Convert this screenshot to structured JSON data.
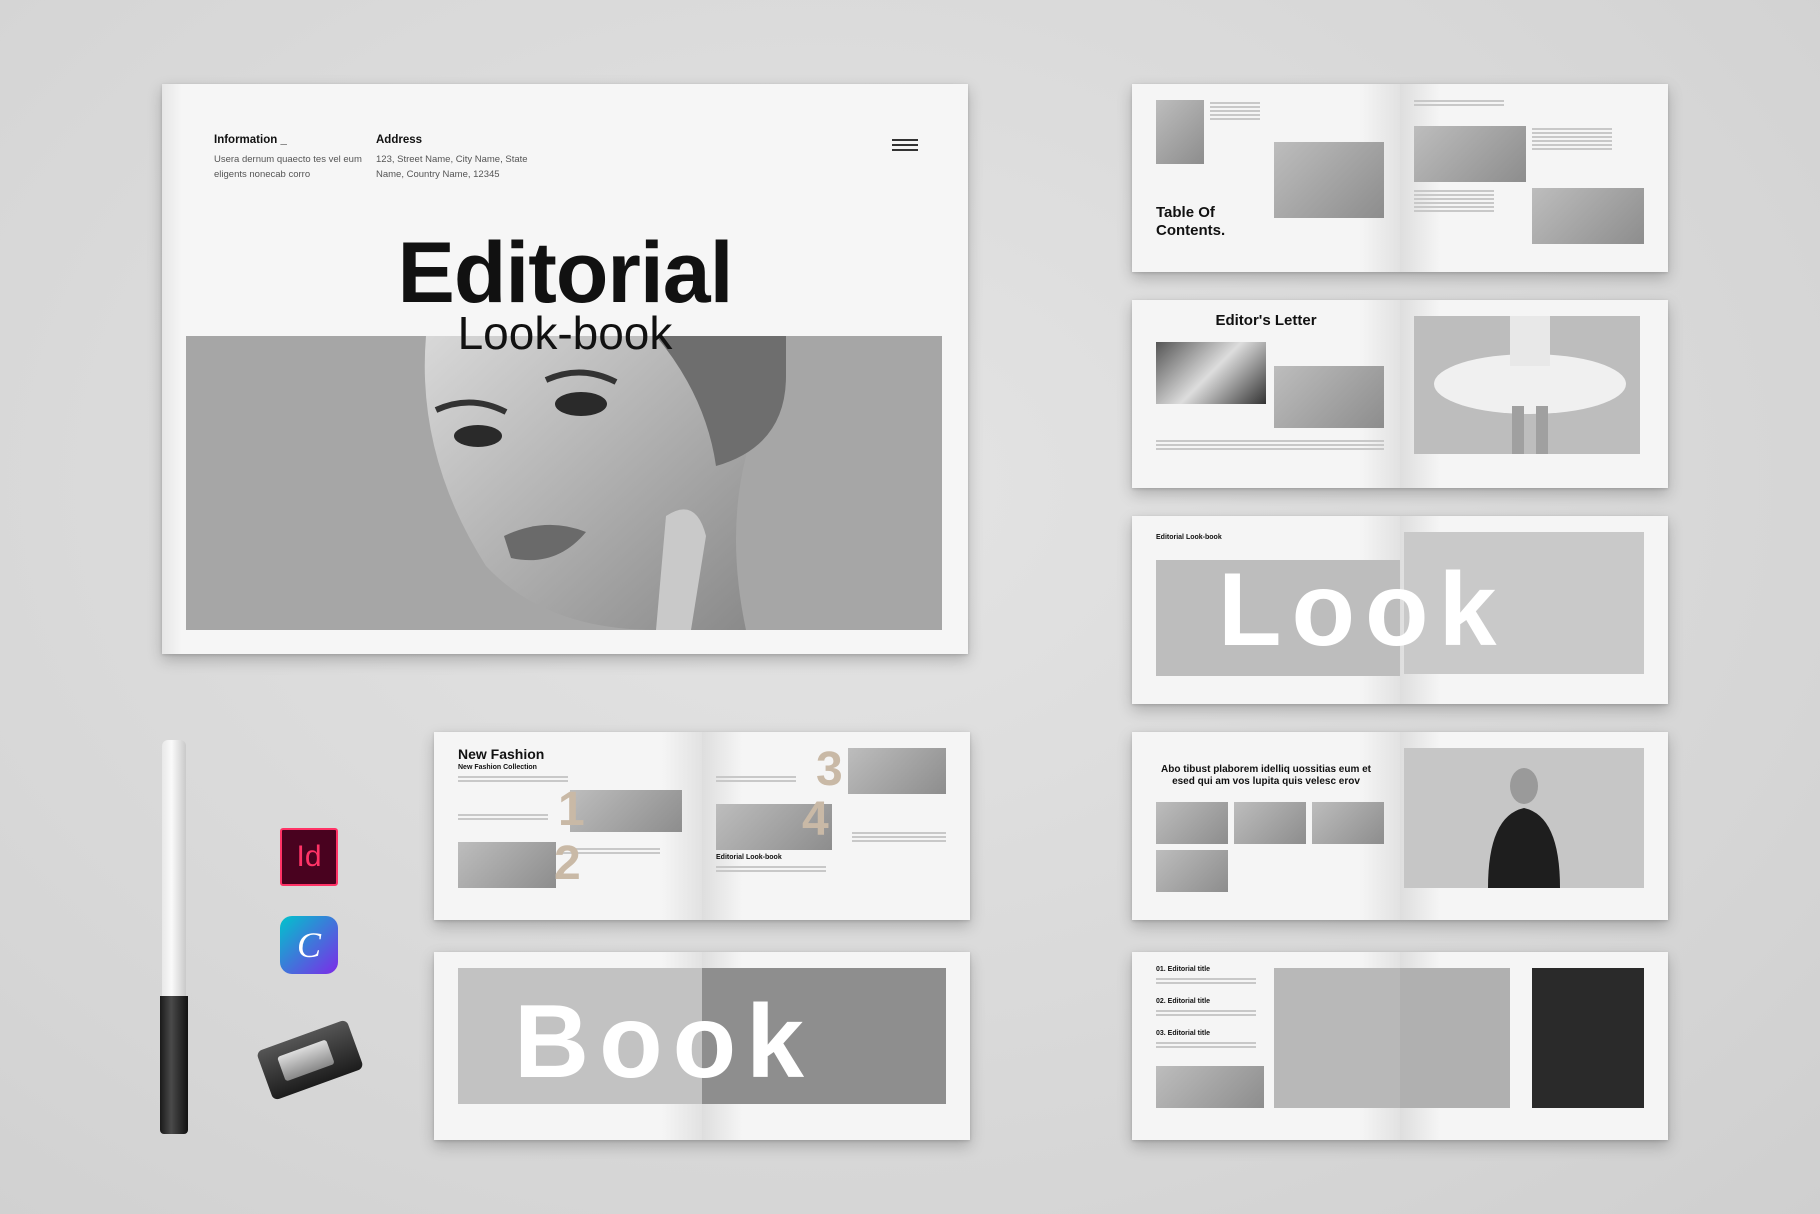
{
  "cover": {
    "info_heading": "Information _",
    "info_text": "Usera dernum quaecto tes vel eum eligents nonecab corro",
    "address_heading": "Address",
    "address_text": "123, Street Name, City Name, State Name, Country Name, 12345",
    "title": "Editorial",
    "subtitle": "Look-book"
  },
  "spreads": {
    "toc": {
      "title": "Table Of Contents."
    },
    "letter": {
      "title": "Editor's Letter"
    },
    "look": {
      "word": "Look",
      "label": "Editorial Look-book"
    },
    "quote": {
      "text": "Abo tibust plaborem idelliq uossitias eum et esed qui am vos lupita quis velesc erov"
    },
    "titles": {
      "items": [
        "01. Editorial title",
        "02. Editorial title",
        "03. Editorial title"
      ]
    },
    "fashion": {
      "title": "New Fashion",
      "subtitle": "New Fashion Collection",
      "label2": "Editorial Look-book",
      "numbers": [
        "1",
        "2",
        "3",
        "4"
      ]
    },
    "book": {
      "word": "Book"
    }
  },
  "apps": {
    "indesign": "Id",
    "canva": "C"
  },
  "colors": {
    "indesign": "#ff3366",
    "indesign_bg": "#49021f",
    "canva_a": "#00c4cc",
    "canva_b": "#7d2ae8",
    "number": "#c9b9a6"
  }
}
